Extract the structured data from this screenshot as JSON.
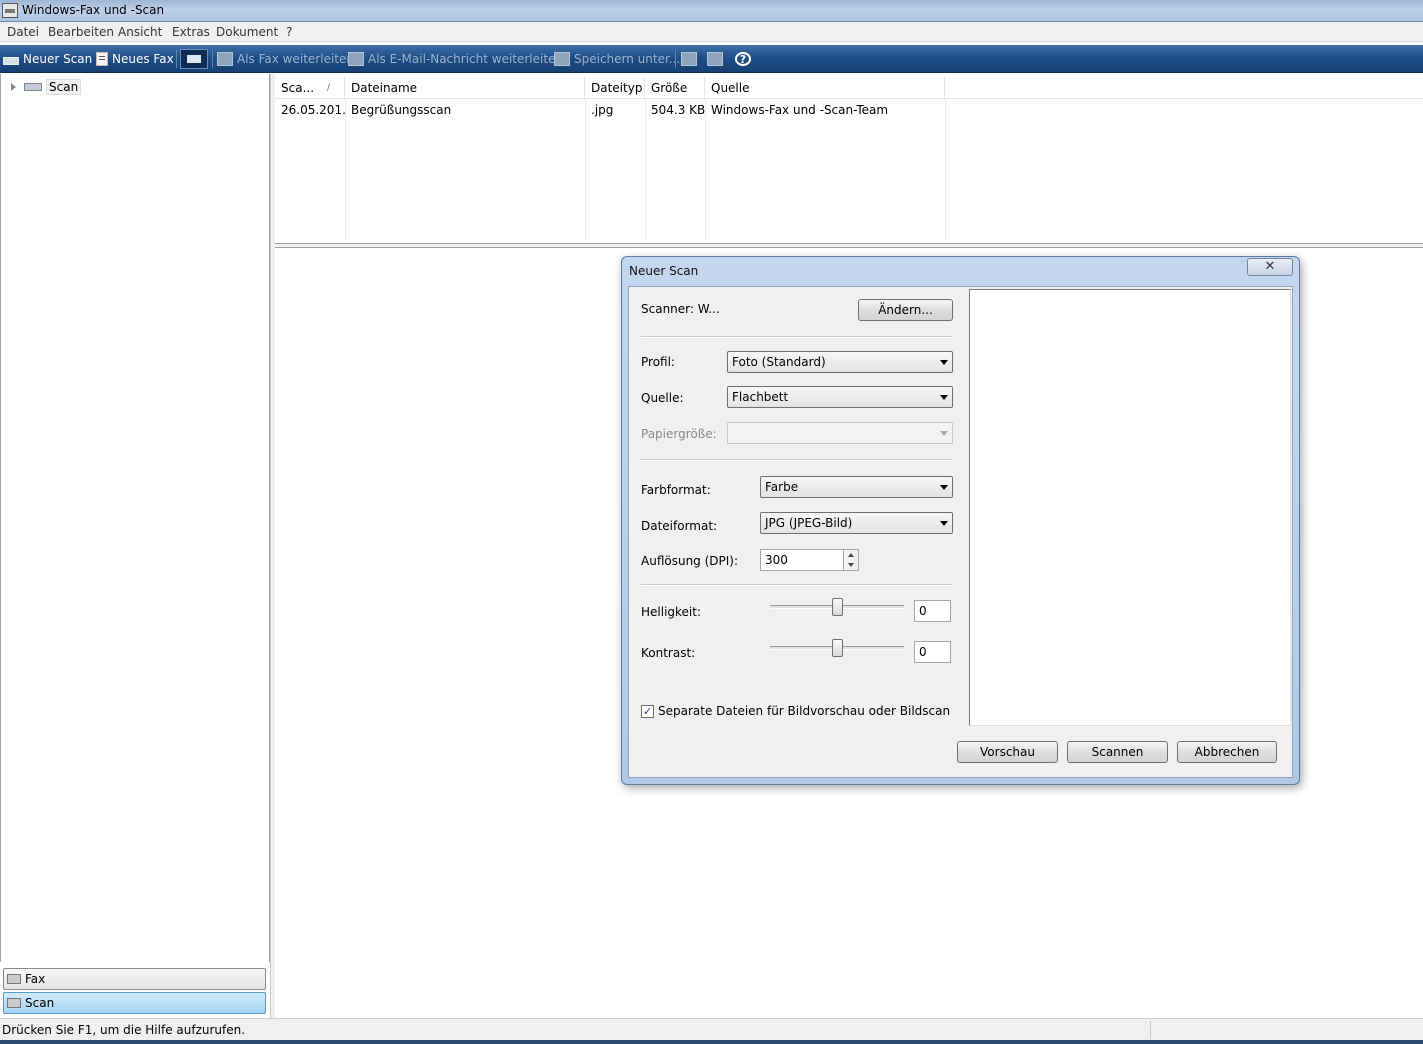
{
  "window": {
    "title": "Windows-Fax und -Scan"
  },
  "menu": [
    "Datei",
    "Bearbeiten",
    "Ansicht",
    "Extras",
    "Dokument",
    "?"
  ],
  "toolbar": {
    "new_scan": "Neuer Scan",
    "new_fax": "Neues Fax",
    "forward_fax": "Als Fax weiterleiten",
    "forward_email": "Als E-Mail-Nachricht weiterleiten",
    "save_as": "Speichern unter...",
    "help_glyph": "?"
  },
  "tree": {
    "scan_label": "Scan"
  },
  "nav": {
    "fax": "Fax",
    "scan": "Scan"
  },
  "list": {
    "columns": [
      "Sca...",
      "Dateiname",
      "Dateityp",
      "Größe",
      "Quelle"
    ],
    "sort_glyph": "/",
    "rows": [
      {
        "date": "26.05.201...",
        "name": "Begrüßungsscan",
        "type": ".jpg",
        "size": "504.3 KB",
        "source": "Windows-Fax und -Scan-Team"
      }
    ]
  },
  "status": {
    "text": "Drücken Sie F1, um die Hilfe aufzurufen."
  },
  "dialog": {
    "title": "Neuer Scan",
    "close_glyph": "✕",
    "scanner_label": "Scanner: W...",
    "change_button": "Ändern...",
    "profile_label": "Profil:",
    "profile_value": "Foto (Standard)",
    "source_label": "Quelle:",
    "source_value": "Flachbett",
    "paper_label": "Papiergröße:",
    "paper_value": "",
    "color_label": "Farbformat:",
    "color_value": "Farbe",
    "filetype_label": "Dateiformat:",
    "filetype_value": "JPG (JPEG-Bild)",
    "resolution_label": "Auflösung (DPI):",
    "resolution_value": "300",
    "brightness_label": "Helligkeit:",
    "brightness_value": "0",
    "contrast_label": "Kontrast:",
    "contrast_value": "0",
    "separate_files_label": "Separate Dateien für Bildvorschau oder Bildscan",
    "separate_files_checked": true,
    "check_glyph": "✓",
    "preview_button": "Vorschau",
    "scan_button": "Scannen",
    "cancel_button": "Abbrechen"
  }
}
